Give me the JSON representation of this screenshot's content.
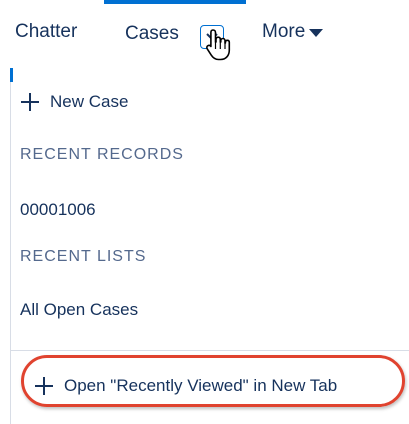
{
  "nav": {
    "chatter": "Chatter",
    "cases": "Cases",
    "more": "More"
  },
  "menu": {
    "new_case": "New Case",
    "recent_records_label": "RECENT RECORDS",
    "recent_records": [
      "00001006"
    ],
    "recent_lists_label": "RECENT LISTS",
    "recent_lists": [
      "All Open Cases"
    ],
    "open_in_new_tab": "Open \"Recently Viewed\" in New Tab"
  },
  "icons": {
    "cases_toggle": "chevron-down-icon",
    "cursor": "hand-pointer-icon",
    "more_caret": "caret-down-icon",
    "plus": "plus-icon"
  },
  "colors": {
    "active_tab_accent": "#0070d2",
    "text": "#16325c",
    "section_label": "#54698d",
    "highlight": "#e0432f"
  }
}
